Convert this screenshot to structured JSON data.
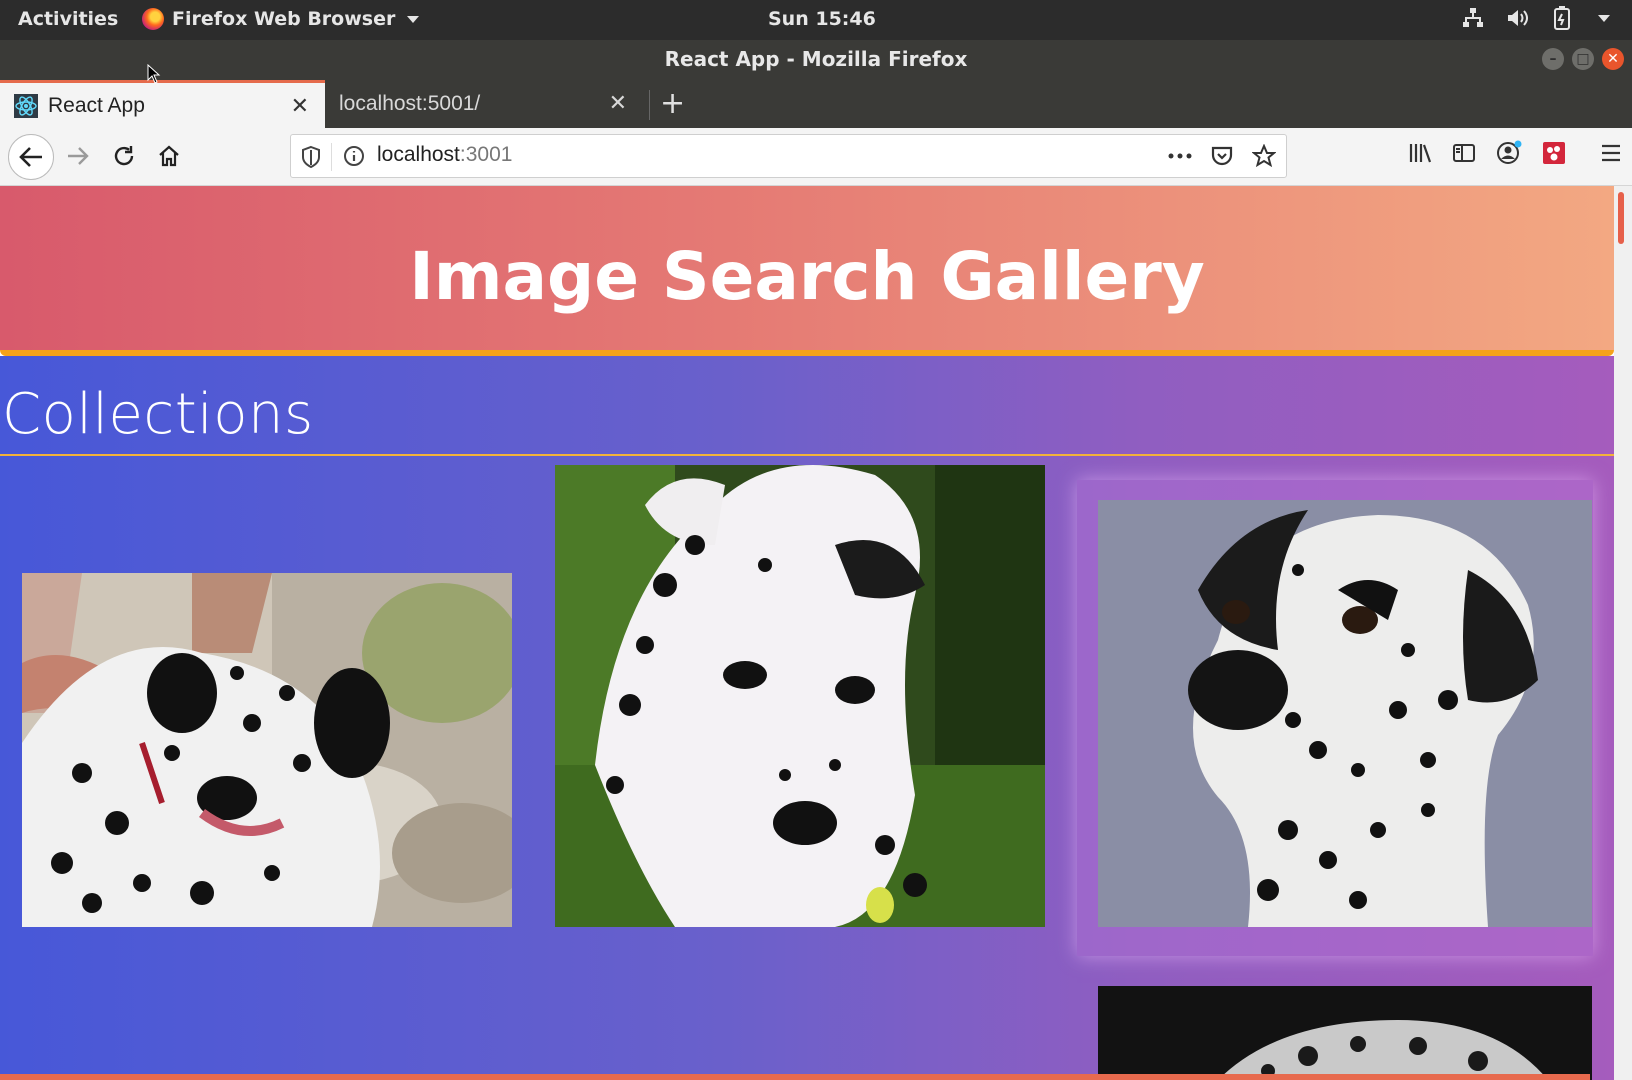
{
  "system_bar": {
    "activities": "Activities",
    "app_name": "Firefox Web Browser",
    "clock": "Sun 15:46"
  },
  "window": {
    "title": "React App - Mozilla Firefox"
  },
  "tabs": [
    {
      "label": "React App",
      "active": true
    },
    {
      "label": "localhost:5001/",
      "active": false
    }
  ],
  "urlbar": {
    "host": "localhost",
    "port": ":3001"
  },
  "page": {
    "heading": "Image Search Gallery",
    "section_title": "Collections",
    "images": [
      {
        "subject": "dalmatian on rocks"
      },
      {
        "subject": "dalmatian on grass"
      },
      {
        "subject": "dalmatian figurine"
      },
      {
        "subject": "dalmatian black background"
      }
    ]
  },
  "colors": {
    "hero_start": "#d85a6c",
    "hero_end": "#f3a882",
    "hero_border": "#f5a21a",
    "content_start": "#4758d8",
    "content_end": "#a55cbd",
    "tab_accent": "#e56b4c"
  }
}
